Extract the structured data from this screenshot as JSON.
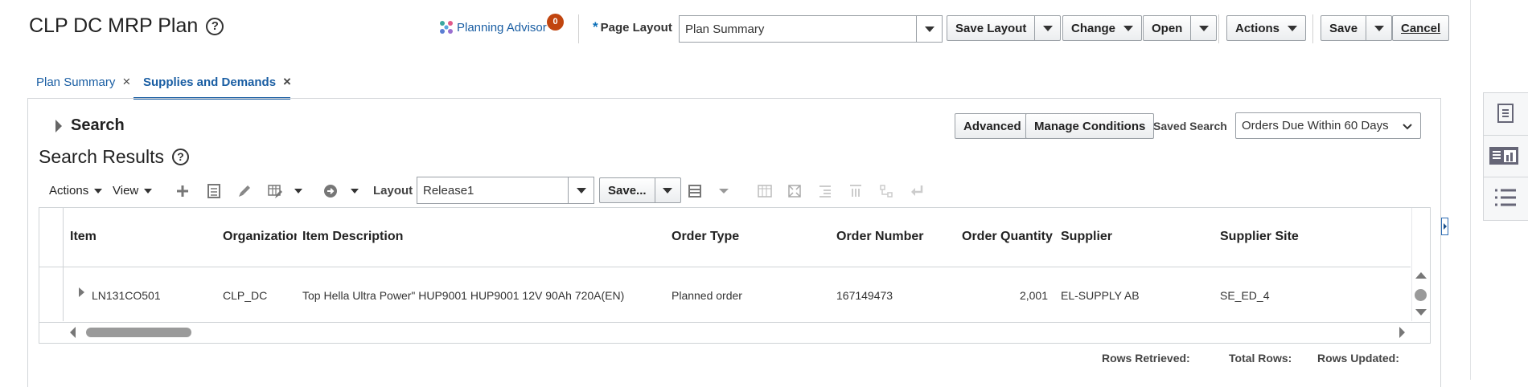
{
  "header": {
    "title": "CLP DC MRP Plan",
    "help_glyph": "?",
    "advisor_label": "Planning Advisor",
    "advisor_count": "0",
    "page_layout_required": "*",
    "page_layout_label": "Page Layout",
    "page_layout_value": "Plan Summary",
    "save_layout_label": "Save Layout",
    "change_label": "Change",
    "open_label": "Open",
    "actions_label": "Actions",
    "save_label": "Save",
    "cancel_label": "Cancel"
  },
  "tabs": [
    {
      "label": "Plan Summary",
      "close": "×"
    },
    {
      "label": "Supplies and Demands",
      "close": "×"
    }
  ],
  "search": {
    "title": "Search",
    "advanced_label": "Advanced",
    "manage_conditions_label": "Manage Conditions",
    "saved_search_label": "Saved Search",
    "saved_search_value": "Orders Due Within 60 Days"
  },
  "results": {
    "title": "Search Results",
    "toolbar": {
      "actions_label": "Actions",
      "view_label": "View",
      "layout_label": "Layout",
      "layout_value": "Release1",
      "save_label": "Save..."
    },
    "columns": [
      "Item",
      "Organization",
      "Item Description",
      "Order Type",
      "Order Number",
      "Order Quantity",
      "Supplier",
      "Supplier Site"
    ],
    "rows": [
      {
        "item": "LN131CO501",
        "organization": "CLP_DC",
        "description": "Top Hella Ultra Power\" HUP9001 HUP9001 12V 90Ah 720A(EN)",
        "order_type": "Planned order",
        "order_number": "167149473",
        "order_quantity": "2,001",
        "supplier": "EL-SUPPLY AB",
        "supplier_site": "SE_ED_4"
      }
    ],
    "footer": {
      "rows_retrieved": "Rows Retrieved:",
      "total_rows": "Total Rows:",
      "rows_updated": "Rows Updated:"
    }
  },
  "colors": {
    "accent": "#1a5ea3",
    "badge": "#c1450f"
  }
}
